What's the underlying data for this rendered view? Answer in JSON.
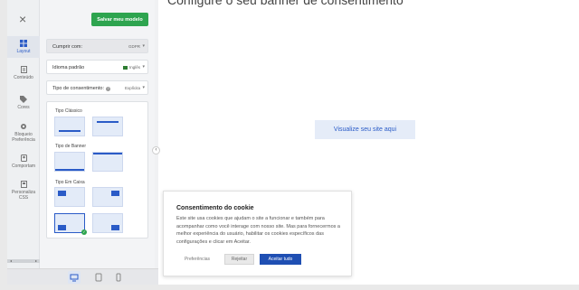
{
  "preview": {
    "title": "Configure o seu banner de consentimento",
    "cta_label": "Visualize seu site aqui"
  },
  "toolbar": {
    "save_label": "Salvar meu modelo"
  },
  "rail": {
    "items": [
      {
        "label": "Layout",
        "icon": "layout-grid-icon",
        "active": true
      },
      {
        "label": "Conteúdo",
        "icon": "document-icon",
        "active": false
      },
      {
        "label": "Cores",
        "icon": "tag-icon",
        "active": false
      },
      {
        "label": "Bloqueio Preferência",
        "icon": "gear-icon",
        "active": false
      },
      {
        "label": "Comportam",
        "icon": "toggle-icon",
        "active": false
      },
      {
        "label": "Personaliza CSS",
        "icon": "css-icon",
        "active": false
      }
    ]
  },
  "settings": {
    "comply_label": "Cumprir com:",
    "comply_value": "GDPR",
    "lang_label": "Idioma padrão",
    "lang_value": "Inglês",
    "consent_type_label": "Tipo de consentimento:",
    "consent_type_value": "Explícita"
  },
  "layout_types": {
    "classic": "Tipo Clássico",
    "banner": "Tipo de Banner",
    "box": "Tipo Em Caixa"
  },
  "devices": [
    "desktop-icon",
    "tablet-icon",
    "mobile-icon"
  ],
  "cookie_banner": {
    "title": "Consentimento do cookie",
    "text": "Este site usa cookies que ajudam o site a funcionar e também para acompanhar como você interage com nosso site. Mas para fornecermos a melhor experiência do usuário, habilitar os cookies específicos das configurações e clicar em Aceitar.",
    "preferences_label": "Preferências",
    "reject_label": "Rejeitar",
    "accept_label": "Aceitar tudo"
  },
  "colors": {
    "accent": "#2a5bc7",
    "save": "#2ea44f",
    "accept": "#1f4fb3"
  }
}
